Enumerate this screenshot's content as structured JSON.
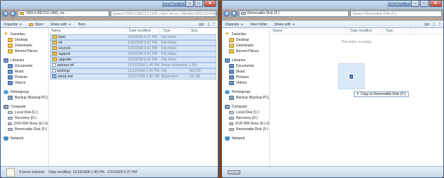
{
  "left": {
    "feedback": "Send Feedback",
    "address": "7000.0.081212-1400_cle...",
    "search_placeholder": "Search 7000.0.081212-1400_client_en-us_Ultimate-GB1CULFRE_EN_DVD",
    "toolbar": {
      "organize": "Organize",
      "open": "Open",
      "share": "Share with",
      "burn": "Burn"
    },
    "columns": {
      "name": "Name",
      "date": "Date modified",
      "type": "Type",
      "size": "Size"
    },
    "files": [
      {
        "name": "boot",
        "date": "1/20/2009 6:37 PM",
        "type": "File folder",
        "size": "",
        "icon": "folder"
      },
      {
        "name": "efi",
        "date": "1/20/2009 6:37 PM",
        "type": "File folder",
        "size": "",
        "icon": "folder"
      },
      {
        "name": "sources",
        "date": "1/20/2009 6:41 PM",
        "type": "File folder",
        "size": "",
        "icon": "folder"
      },
      {
        "name": "support",
        "date": "1/20/2009 6:41 PM",
        "type": "File folder",
        "size": "",
        "icon": "folder"
      },
      {
        "name": "upgrade",
        "date": "1/20/2009 6:41 PM",
        "type": "File folder",
        "size": "",
        "icon": "folder"
      },
      {
        "name": "autorun.inf",
        "date": "12/13/2008 1:45 PM",
        "type": "Setup Information",
        "size": "1 KB",
        "icon": "file"
      },
      {
        "name": "bootmgr",
        "date": "12/13/2008 1:45 PM",
        "type": "File",
        "size": "369 KB",
        "icon": "file"
      },
      {
        "name": "setup.exe",
        "date": "12/13/2008 1:45 PM",
        "type": "Application",
        "size": "111 KB",
        "icon": "exe"
      }
    ],
    "status": {
      "count": "8 items selected",
      "date": "Date modified: 12/13/2008 1:45 PM - 1/20/2009 6:37 PM"
    }
  },
  "right": {
    "feedback": "Send Feedback",
    "address": "Removable Disk (F:)",
    "search_placeholder": "Search Removable Disk (F:)",
    "toolbar": {
      "organize": "Organize",
      "new_folder": "New folder",
      "share": "Share with"
    },
    "columns": {
      "name": "Name",
      "date": "Date modified",
      "type": "Type"
    },
    "empty_message": "This folder is empty.",
    "drop_tip": "Copy to Removable Disk (F:)"
  },
  "nav": {
    "favorites": "Favorites",
    "fav_items": [
      "Desktop",
      "Downloads",
      "Recent Places"
    ],
    "libraries": "Libraries",
    "lib_items": [
      "Documents",
      "Music",
      "Pictures",
      "Videos"
    ],
    "homegroup": "Homegroup",
    "home_items": [
      "Backup (Backup-PC)"
    ],
    "computer": "Computer",
    "comp_items": [
      "Local Disk (C:)",
      "Recovery (D:)",
      "DVD RW Drive (E:) G",
      "Removable Disk (F:)"
    ],
    "network": "Network"
  }
}
